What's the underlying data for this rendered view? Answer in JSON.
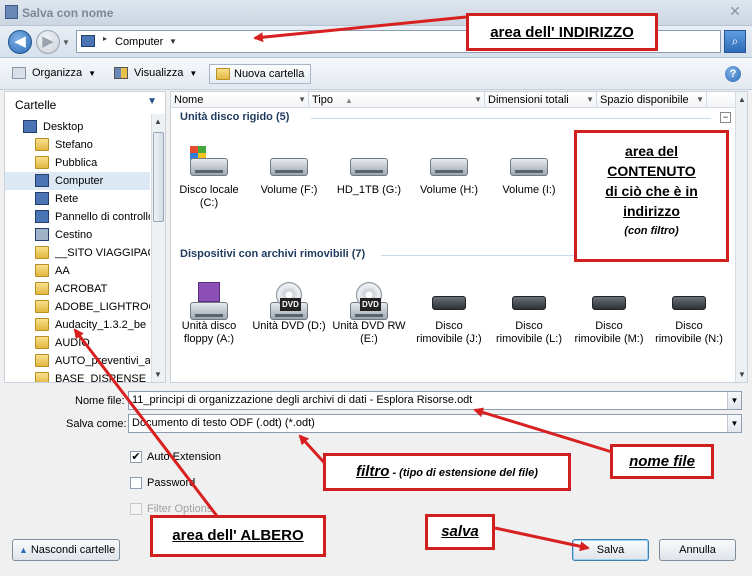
{
  "window": {
    "title": "Salva con nome",
    "close_glyph": "✕"
  },
  "address": {
    "back_glyph": "◀",
    "forward_glyph": "▶",
    "path": "Computer",
    "search_glyph": "⌕"
  },
  "toolbar": {
    "organize": "Organizza",
    "view": "Visualizza",
    "new_folder": "Nuova cartella",
    "help": "?"
  },
  "tree": {
    "header": "Cartelle",
    "items": [
      {
        "label": "Desktop",
        "icon": "desktop-icon"
      },
      {
        "label": "Stefano",
        "icon": "folder-icon"
      },
      {
        "label": "Pubblica",
        "icon": "folder-icon"
      },
      {
        "label": "Computer",
        "icon": "computer-icon"
      },
      {
        "label": "Rete",
        "icon": "network-icon"
      },
      {
        "label": "Pannello di controllo",
        "icon": "control-panel-icon"
      },
      {
        "label": "Cestino",
        "icon": "recycle-bin-icon"
      },
      {
        "label": "__SITO VIAGGIPAC",
        "icon": "folder-icon"
      },
      {
        "label": "AA",
        "icon": "folder-icon"
      },
      {
        "label": "ACROBAT",
        "icon": "folder-icon"
      },
      {
        "label": "ADOBE_LIGHTROO",
        "icon": "folder-icon"
      },
      {
        "label": "Audacity_1.3.2_be",
        "icon": "folder-icon"
      },
      {
        "label": "AUDIO",
        "icon": "folder-icon"
      },
      {
        "label": "AUTO_preventivi_a",
        "icon": "folder-icon"
      },
      {
        "label": "BASE_DISPENSE_S",
        "icon": "folder-icon"
      }
    ]
  },
  "columns": [
    "Nome",
    "Tipo",
    "Dimensioni totali",
    "Spazio disponibile"
  ],
  "groups": {
    "hard_disks": {
      "title": "Unità disco rigido (5)",
      "items": [
        {
          "line1": "Disco locale",
          "line2": "(C:)",
          "icon": "system-drive-icon"
        },
        {
          "line1": "Volume (F:)",
          "line2": "",
          "icon": "hard-disk-icon"
        },
        {
          "line1": "HD_1TB (G:)",
          "line2": "",
          "icon": "hard-disk-icon"
        },
        {
          "line1": "Volume (H:)",
          "line2": "",
          "icon": "hard-disk-icon"
        },
        {
          "line1": "Volume (I:)",
          "line2": "",
          "icon": "hard-disk-icon"
        }
      ]
    },
    "removable": {
      "title": "Dispositivi con archivi rimovibili (7)",
      "items": [
        {
          "line1": "Unità disco",
          "line2": "floppy (A:)",
          "icon": "floppy-icon"
        },
        {
          "line1": "Unità DVD (D:)",
          "line2": "",
          "icon": "dvd-icon",
          "badge": "DVD"
        },
        {
          "line1": "Unità DVD RW",
          "line2": "(E:)",
          "icon": "dvd-icon",
          "badge": "DVD"
        },
        {
          "line1": "Disco",
          "line2": "rimovibile (J:)",
          "icon": "removable-disk-icon"
        },
        {
          "line1": "Disco",
          "line2": "rimovibile (L:)",
          "icon": "removable-disk-icon"
        },
        {
          "line1": "Disco",
          "line2": "rimovibile (M:)",
          "icon": "removable-disk-icon"
        },
        {
          "line1": "Disco",
          "line2": "rimovibile (N:)",
          "icon": "removable-disk-icon"
        }
      ]
    }
  },
  "form": {
    "filename_label": "Nome file:",
    "filename_value": "11_principi di organizzazione degli archivi di dati - Esplora Risorse.odt",
    "type_label": "Salva come:",
    "type_value": "Documento di testo ODF (.odt) (*.odt)",
    "auto_extension": "Auto Extension",
    "password": "Password",
    "filter_options": "Filter Options",
    "check_mark": "✔"
  },
  "buttons": {
    "hide_folders": "Nascondi cartelle",
    "save": "Salva",
    "cancel": "Annulla"
  },
  "annotations": {
    "address": "area dell' INDIRIZZO",
    "content_l1": "area del",
    "content_l2": "CONTENUTO",
    "content_l3": "di ciò che è in",
    "content_l4": "indirizzo",
    "content_l5": "(con filtro)",
    "filename": "nome file",
    "filter_bold": "filtro",
    "filter_rest": " - (tipo di estensione del file)",
    "tree": "area dell' ALBERO",
    "save": "salva"
  },
  "colors": {
    "annotation_border": "#cf1f1f",
    "arrow": "#d92020"
  }
}
